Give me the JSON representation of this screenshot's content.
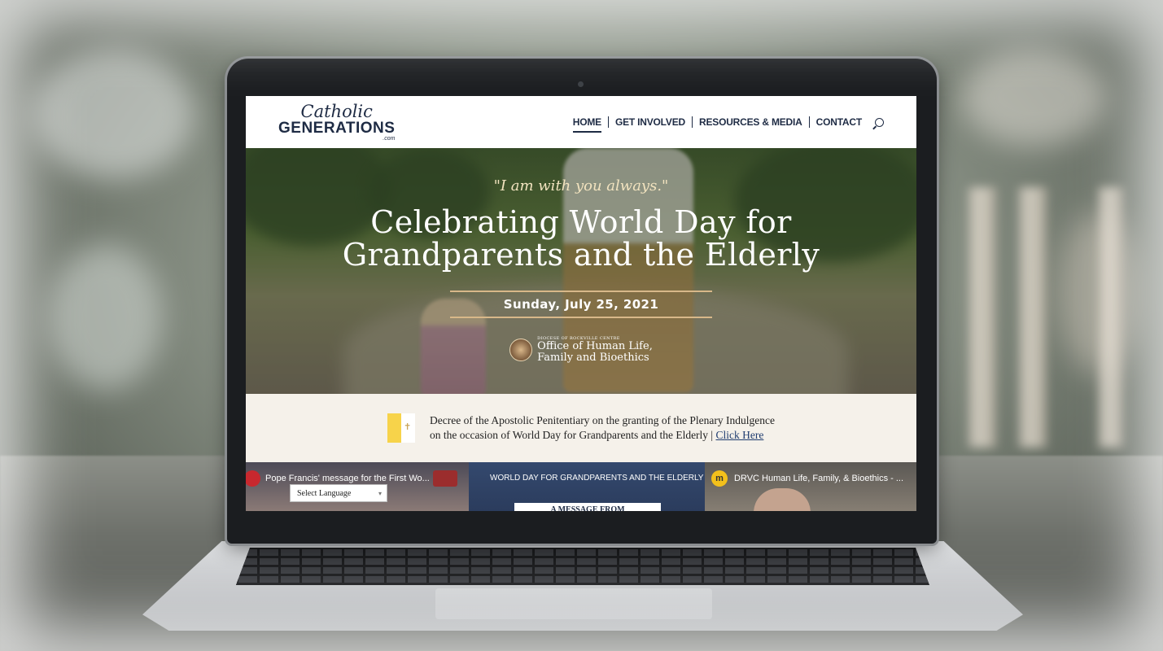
{
  "site": {
    "logo": {
      "script": "Catholic",
      "main": "GENERATIONS",
      "suffix": ".com"
    },
    "nav": [
      {
        "label": "HOME",
        "active": true
      },
      {
        "label": "GET INVOLVED",
        "active": false
      },
      {
        "label": "RESOURCES & MEDIA",
        "active": false
      },
      {
        "label": "CONTACT",
        "active": false
      }
    ],
    "search_icon": "search-icon"
  },
  "hero": {
    "quote": "\"I am with you always.\"",
    "title_line1": "Celebrating World Day for",
    "title_line2": "Grandparents and the Elderly",
    "date": "Sunday, July 25, 2021",
    "office": {
      "small": "DIOCESE OF ROCKVILLE CENTRE",
      "line1": "Office of Human Life,",
      "line2": "Family and Bioethics"
    }
  },
  "decree": {
    "line1": "Decree of the Apostolic Penitentiary on the granting of the Plenary Indulgence",
    "line2": "on the occasion of World Day for Grandparents and the Elderly | ",
    "link": "Click Here"
  },
  "videos": [
    {
      "title": "Pope Francis' message for the First Wo...",
      "language_select": "Select Language"
    },
    {
      "title": "WORLD DAY FOR GRANDPARENTS AND THE ELDERLY",
      "button": "A MESSAGE FROM"
    },
    {
      "title": "DRVC Human Life, Family, & Bioethics - ...",
      "channel_initial": "m"
    }
  ],
  "colors": {
    "navy": "#1e2b44",
    "gold": "#d8b889",
    "cream": "#f5f1ea",
    "vatican_yellow": "#f7d34a"
  }
}
